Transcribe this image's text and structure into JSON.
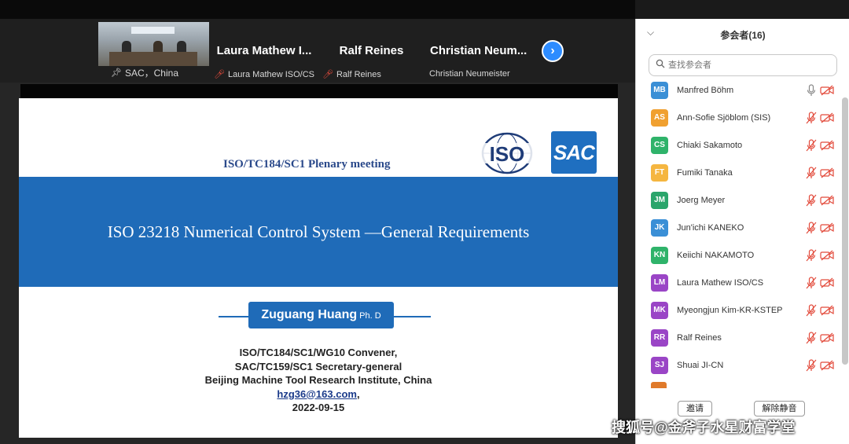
{
  "video_strip": {
    "tiles": [
      {
        "name": "",
        "sub": "SAC，China"
      },
      {
        "name": "Laura Mathew I...",
        "sub": "Laura Mathew ISO/CS"
      },
      {
        "name": "Ralf Reines",
        "sub": "Ralf Reines"
      },
      {
        "name": "Christian  Neum...",
        "sub": "Christian Neumeister"
      }
    ],
    "next_label": "›"
  },
  "slide": {
    "meeting": "ISO/TC184/SC1 Plenary meeting",
    "iso_logo_text": "ISO",
    "sac_logo_text": "SAC",
    "title": "ISO 23218  Numerical  Control System —General Requirements",
    "presenter": "Zuguang Huang",
    "degree": "Ph. D",
    "info": [
      "ISO/TC184/SC1/WG10 Convener,",
      "SAC/TC159/SC1  Secretary-general",
      "Beijing Machine Tool Research Institute, China"
    ],
    "email": "hzg36@163.com",
    "email_suffix": ",",
    "date": "2022-09-15"
  },
  "panel": {
    "title": "参会者(16)",
    "search_placeholder": "查找参会者",
    "participants": [
      {
        "initials": "MB",
        "name": "Manfred Böhm",
        "color": "#3a8fd6",
        "mic": "on"
      },
      {
        "initials": "AS",
        "name": "Ann-Sofie Sjöblom (SIS)",
        "color": "#f0a030",
        "mic": "off"
      },
      {
        "initials": "CS",
        "name": "Chiaki Sakamoto",
        "color": "#2fb36a",
        "mic": "off"
      },
      {
        "initials": "FT",
        "name": "Fumiki Tanaka",
        "color": "#f5b640",
        "mic": "off"
      },
      {
        "initials": "JM",
        "name": "Joerg Meyer",
        "color": "#2aa56b",
        "mic": "off"
      },
      {
        "initials": "JK",
        "name": "Jun'ichi KANEKO",
        "color": "#3a8fd6",
        "mic": "off"
      },
      {
        "initials": "KN",
        "name": "Keiichi NAKAMOTO",
        "color": "#2fb36a",
        "mic": "off"
      },
      {
        "initials": "LM",
        "name": "Laura Mathew ISO/CS",
        "color": "#9a45c6",
        "mic": "off"
      },
      {
        "initials": "MK",
        "name": "Myeongjun Kim-KR-KSTEP",
        "color": "#9a45c6",
        "mic": "off"
      },
      {
        "initials": "RR",
        "name": "Ralf Reines",
        "color": "#9a45c6",
        "mic": "off"
      },
      {
        "initials": "SJ",
        "name": "Shuai  JI-CN",
        "color": "#9a45c6",
        "mic": "off"
      }
    ],
    "invite_label": "邀请",
    "unmute_label": "解除静音"
  },
  "watermark": "搜狐号@金斧子水星财富学堂",
  "colors": {
    "slide_blue": "#1f6bb8",
    "accent": "#2d8cff",
    "muted_red": "#e24a3b"
  }
}
